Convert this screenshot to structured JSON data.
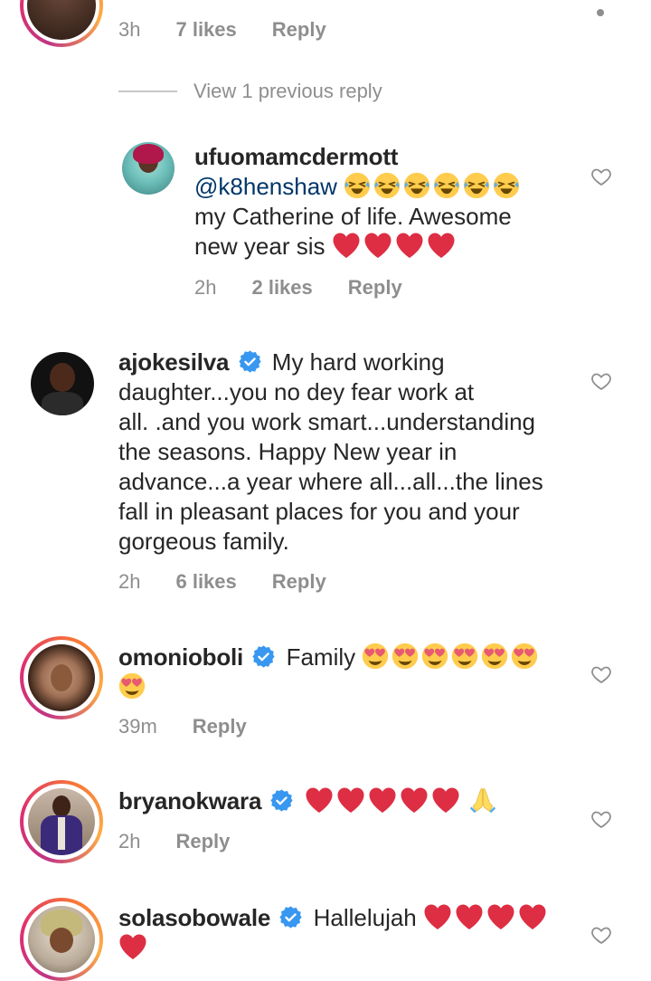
{
  "top_comment": {
    "time": "3h",
    "likes": "7 likes",
    "reply": "Reply"
  },
  "view_previous": "View 1 previous reply",
  "comments": [
    {
      "username": "ufuomamcdermott",
      "mention": "@k8henshaw",
      "text": "my Catherine of life. Awesome new year sis",
      "time": "2h",
      "likes": "2 likes",
      "reply": "Reply"
    },
    {
      "username": "ajokesilva",
      "text_line1": "My hard working",
      "text_rest": [
        "daughter...you no dey fear work at",
        "all. .and you work smart...understanding",
        "the seasons. Happy New year in",
        "advance...a year where all...all...the lines",
        "fall in pleasant places for you and your",
        "gorgeous family."
      ],
      "time": "2h",
      "likes": "6 likes",
      "reply": "Reply"
    },
    {
      "username": "omonioboli",
      "text": "Family",
      "time": "39m",
      "reply": "Reply"
    },
    {
      "username": "bryanokwara",
      "time": "2h",
      "reply": "Reply"
    },
    {
      "username": "solasobowale",
      "text": "Hallelujah"
    }
  ],
  "icons": {
    "like": "heart-outline-icon",
    "verified": "verified-badge-icon",
    "red_heart": "red-heart-emoji",
    "rofl": "rofl-emoji",
    "heart_eyes": "heart-eyes-emoji",
    "pray": "folded-hands-emoji"
  },
  "colors": {
    "text": "#262626",
    "meta": "#8e8e8e",
    "mention": "#00376b",
    "verified": "#3897f0"
  }
}
